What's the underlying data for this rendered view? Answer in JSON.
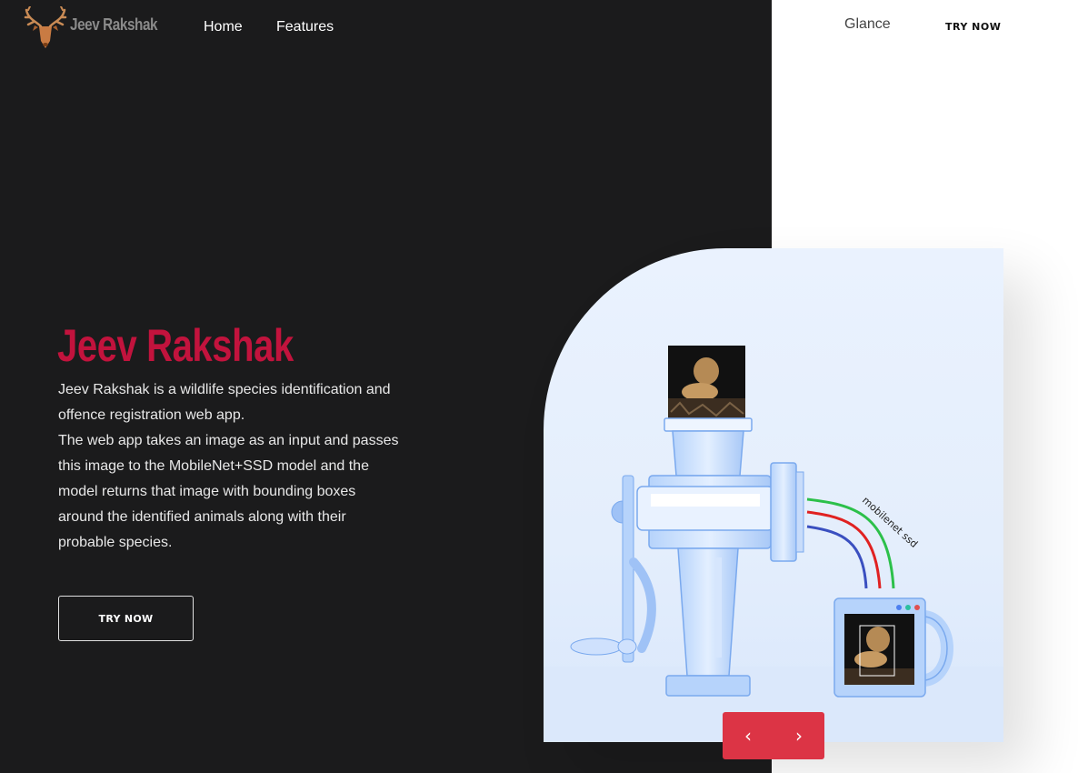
{
  "brand": {
    "name": "Jeev Rakshak"
  },
  "nav": {
    "home": "Home",
    "features": "Features",
    "glance": "Glance",
    "try_now": "TRY NOW"
  },
  "hero": {
    "title": "Jeev Rakshak",
    "description_lines": [
      "Jeev Rakshak is a wildlife species identification and",
      "offence registration web app.",
      "The web app takes an image as an input and passes",
      "this image to the MobileNet+SSD model and the",
      "model returns that image with bounding boxes",
      "around the identified animals along with their",
      "probable species."
    ],
    "button_label": "TRY NOW"
  },
  "illustration": {
    "curve_label": "mobilenet ssd",
    "input_image": "lion-photo",
    "output_image": "lion-photo-with-bounding-box"
  },
  "slider": {
    "prev_icon": "chevron-left-icon",
    "next_icon": "chevron-right-icon",
    "prev_glyph": "‹",
    "next_glyph": "›"
  },
  "colors": {
    "dark_bg": "#1b1b1c",
    "accent": "#c2133d",
    "slider_red": "#dc3445"
  }
}
